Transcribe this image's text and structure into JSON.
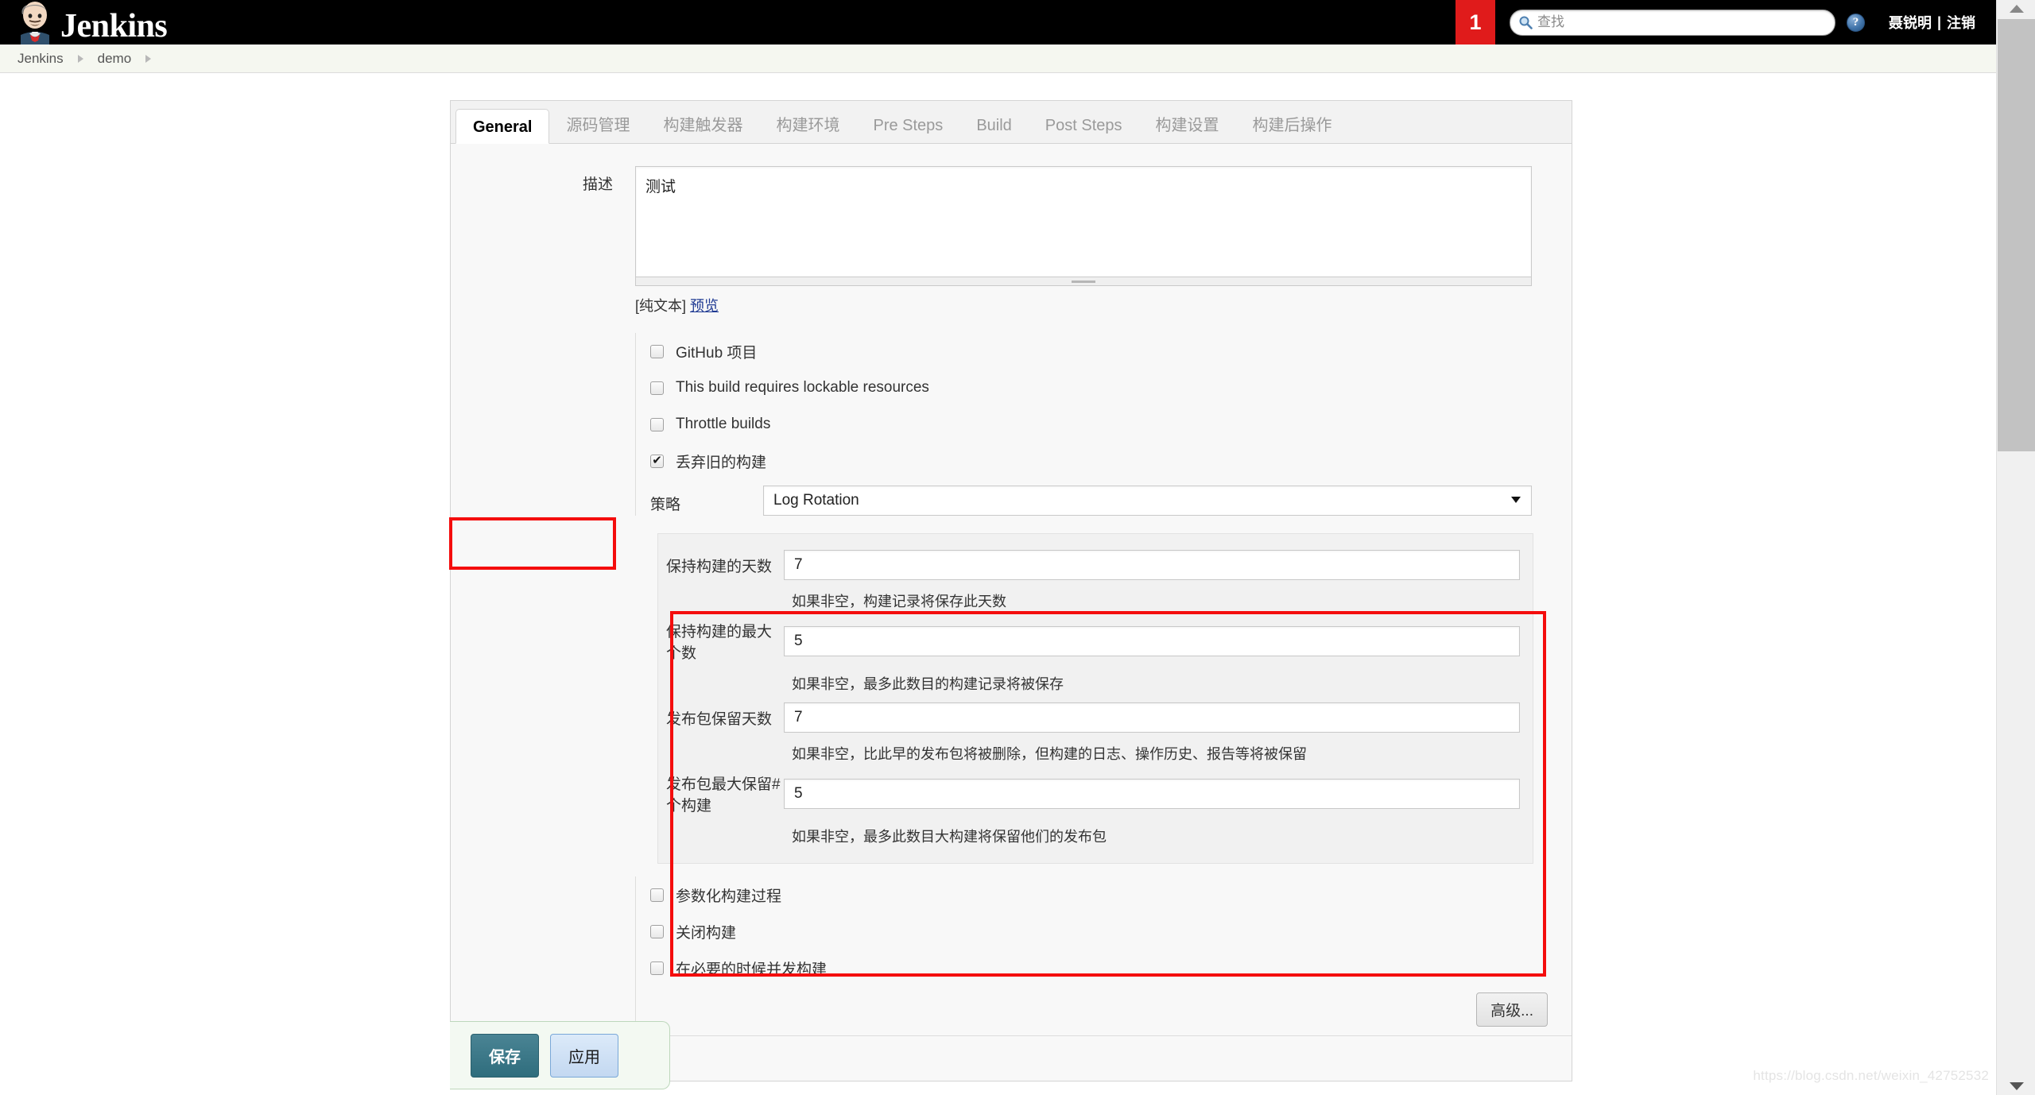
{
  "topbar": {
    "brand": "Jenkins",
    "brand_icon": "jenkins-butler-logo",
    "badge_count": "1",
    "search_placeholder": "查找",
    "search_value": "",
    "search_icon": "search-icon",
    "help_icon": "help-icon",
    "user_name": "聂锐明",
    "separator": "|",
    "logout_label": "注销"
  },
  "breadcrumb": {
    "items": [
      {
        "label": "Jenkins"
      },
      {
        "label": "demo"
      }
    ]
  },
  "tabs": [
    {
      "label": "General",
      "active": true
    },
    {
      "label": "源码管理",
      "active": false
    },
    {
      "label": "构建触发器",
      "active": false
    },
    {
      "label": "构建环境",
      "active": false
    },
    {
      "label": "Pre Steps",
      "active": false
    },
    {
      "label": "Build",
      "active": false
    },
    {
      "label": "Post Steps",
      "active": false
    },
    {
      "label": "构建设置",
      "active": false
    },
    {
      "label": "构建后操作",
      "active": false
    }
  ],
  "form": {
    "description": {
      "label": "描述",
      "value": "测试",
      "plain_text_label": "[纯文本]",
      "preview_link": "预览"
    },
    "checkboxes_top": [
      {
        "label": "GitHub 项目",
        "checked": false,
        "help": false
      },
      {
        "label": "This build requires lockable resources",
        "checked": false,
        "help": false
      },
      {
        "label": "Throttle builds",
        "checked": false,
        "help": true
      },
      {
        "label": "丢弃旧的构建",
        "checked": true,
        "help": true
      }
    ],
    "strategy": {
      "label": "策略",
      "selected": "Log Rotation"
    },
    "rotation_fields": [
      {
        "label": "保持构建的天数",
        "value": "7",
        "help": "如果非空，构建记录将保存此天数"
      },
      {
        "label": "保持构建的最大个数",
        "value": "5",
        "help": "如果非空，最多此数目的构建记录将被保存"
      },
      {
        "label": "发布包保留天数",
        "value": "7",
        "help": "如果非空，比此早的发布包将被删除，但构建的日志、操作历史、报告等将被保留"
      },
      {
        "label": "发布包最大保留#个构建",
        "value": "5",
        "help": "如果非空，最多此数目大构建将保留他们的发布包"
      }
    ],
    "checkboxes_bottom": [
      {
        "label": "参数化构建过程",
        "checked": false,
        "help": true
      },
      {
        "label": "关闭构建",
        "checked": false,
        "help": true
      },
      {
        "label": "在必要的时候并发构建",
        "checked": false,
        "help": true
      }
    ],
    "advanced_button": "高级...",
    "save_button": "保存",
    "apply_button": "应用"
  },
  "annotations": {
    "color": "#f40d0d",
    "boxes": [
      {
        "name": "discard-old-builds-highlight"
      },
      {
        "name": "log-rotation-fields-highlight"
      }
    ]
  },
  "watermark": "https://blog.csdn.net/weixin_42752532"
}
